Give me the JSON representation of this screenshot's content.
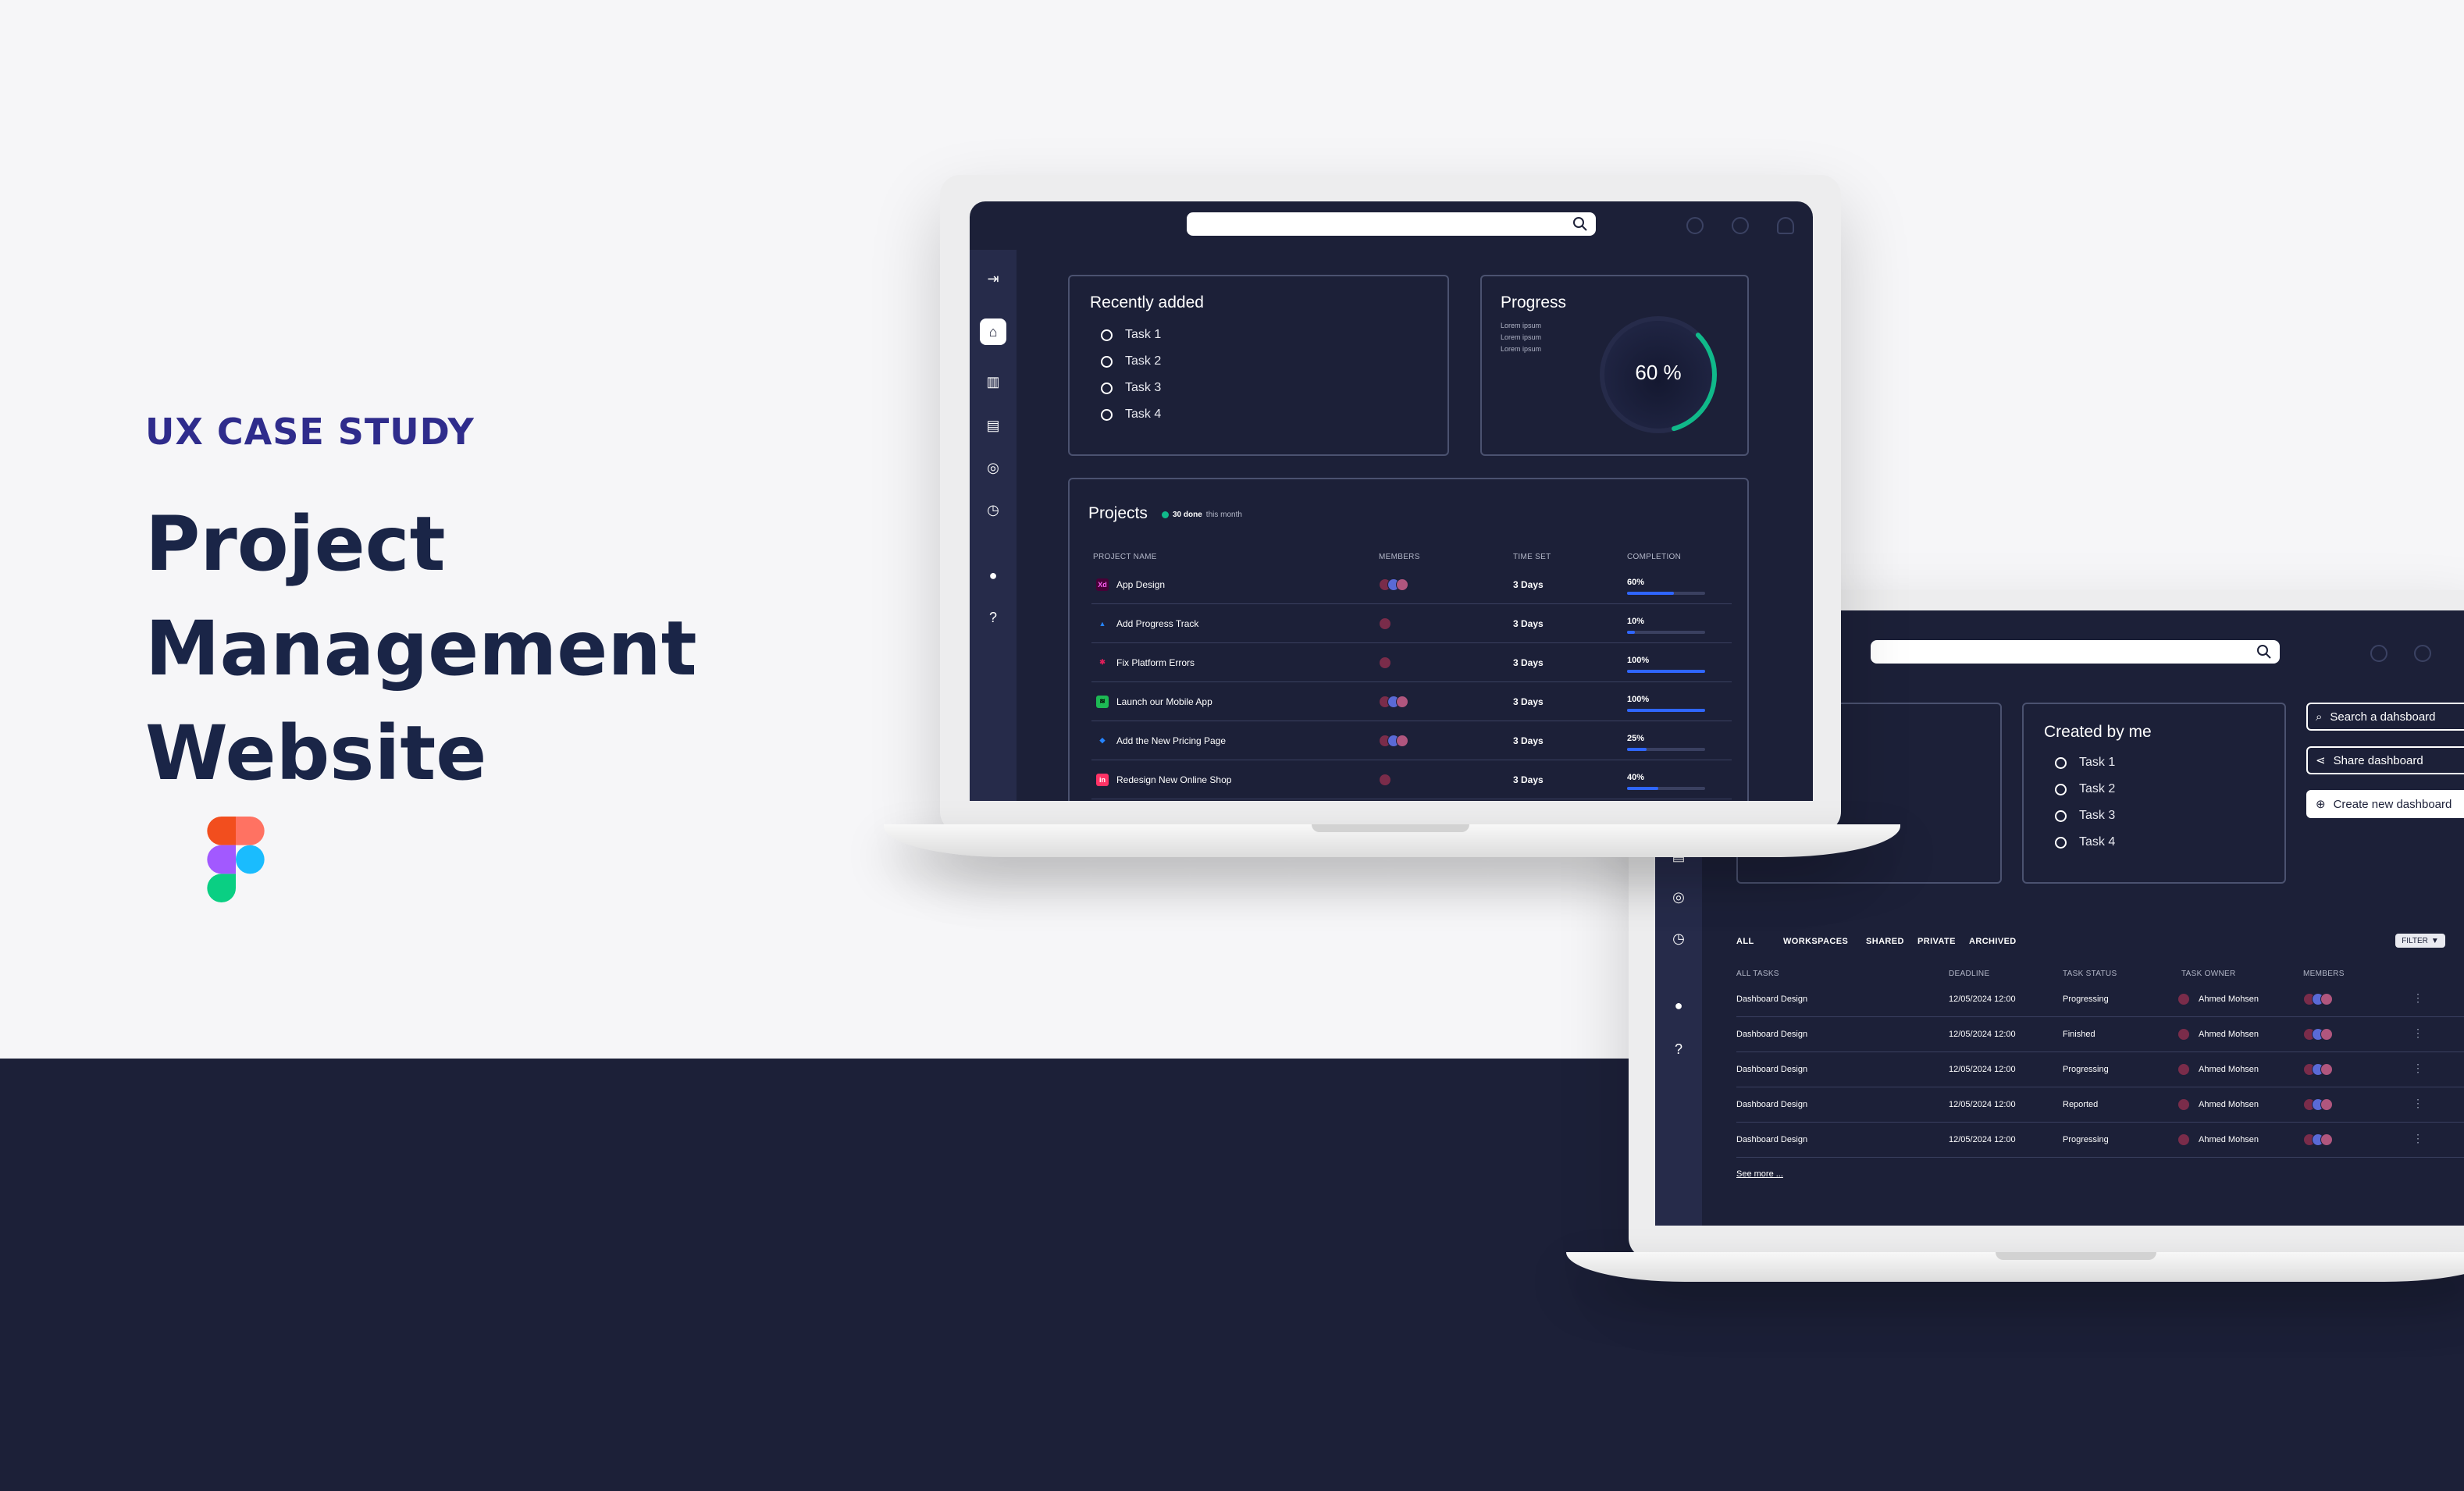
{
  "hero": {
    "kicker": "UX CASE STUDY",
    "title_line1": "Project Management",
    "title_line2": "Website"
  },
  "colors": {
    "accent_blue": "#2f66ff",
    "dark_navy": "#1c2038",
    "sidebar": "#262b4a",
    "progress_green": "#10b98a",
    "kicker_purple": "#2f2c8c"
  },
  "laptop1": {
    "search": {
      "placeholder": ""
    },
    "recent": {
      "title": "Recently added",
      "tasks": [
        "Task 1",
        "Task 2",
        "Task 3",
        "Task 4"
      ]
    },
    "progress": {
      "title": "Progress",
      "lorem": [
        "Lorem ipsum",
        "Lorem ipsum",
        "Lorem ipsum"
      ],
      "value_label": "60 %",
      "value": 0.6
    },
    "projects": {
      "title": "Projects",
      "done_count": "30 done",
      "done_suffix": "this month",
      "headers": [
        "PROJECT NAME",
        "MEMBERS",
        "TIME SET",
        "COMPLETION"
      ],
      "rows": [
        {
          "icon": "xd-icon",
          "icon_text": "Xd",
          "name": "App Design",
          "time": "3 Days",
          "completion_label": "60%",
          "completion": 0.6,
          "members": 3
        },
        {
          "icon": "atlassian-icon",
          "icon_text": "▲",
          "name": "Add Progress Track",
          "time": "3 Days",
          "completion_label": "10%",
          "completion": 0.1,
          "members": 1
        },
        {
          "icon": "slack-icon",
          "icon_text": "✱",
          "name": "Fix Platform Errors",
          "time": "3 Days",
          "completion_label": "100%",
          "completion": 1.0,
          "members": 1
        },
        {
          "icon": "spotify-icon",
          "icon_text": "≋",
          "name": "Launch our Mobile App",
          "time": "3 Days",
          "completion_label": "100%",
          "completion": 1.0,
          "members": 3
        },
        {
          "icon": "jira-icon",
          "icon_text": "◆",
          "name": "Add the New Pricing Page",
          "time": "3 Days",
          "completion_label": "25%",
          "completion": 0.25,
          "members": 3
        },
        {
          "icon": "invision-icon",
          "icon_text": "in",
          "name": "Redesign New Online Shop",
          "time": "3 Days",
          "completion_label": "40%",
          "completion": 0.4,
          "members": 1
        }
      ]
    }
  },
  "laptop2": {
    "created": {
      "title": "Created by me",
      "tasks": [
        "Task 1",
        "Task 2",
        "Task 3",
        "Task 4"
      ]
    },
    "actions": [
      "Search a dahsboard",
      "Share dashboard",
      "Create new dashboard"
    ],
    "tabs": [
      "ALL",
      "WORKSPACES",
      "SHARED",
      "PRIVATE",
      "ARCHIVED"
    ],
    "filter_label": "FILTER",
    "headers": [
      "ALL TASKS",
      "DEADLINE",
      "TASK STATUS",
      "TASK OWNER",
      "MEMBERS"
    ],
    "rows": [
      {
        "task": "Dashboard Design",
        "deadline": "12/05/2024 12:00",
        "status": "Progressing",
        "owner": "Ahmed Mohsen"
      },
      {
        "task": "Dashboard Design",
        "deadline": "12/05/2024 12:00",
        "status": "Finished",
        "owner": "Ahmed Mohsen"
      },
      {
        "task": "Dashboard Design",
        "deadline": "12/05/2024 12:00",
        "status": "Progressing",
        "owner": "Ahmed Mohsen"
      },
      {
        "task": "Dashboard Design",
        "deadline": "12/05/2024 12:00",
        "status": "Reported",
        "owner": "Ahmed Mohsen"
      },
      {
        "task": "Dashboard Design",
        "deadline": "12/05/2024 12:00",
        "status": "Progressing",
        "owner": "Ahmed Mohsen"
      }
    ],
    "see_more": "See more ..."
  }
}
